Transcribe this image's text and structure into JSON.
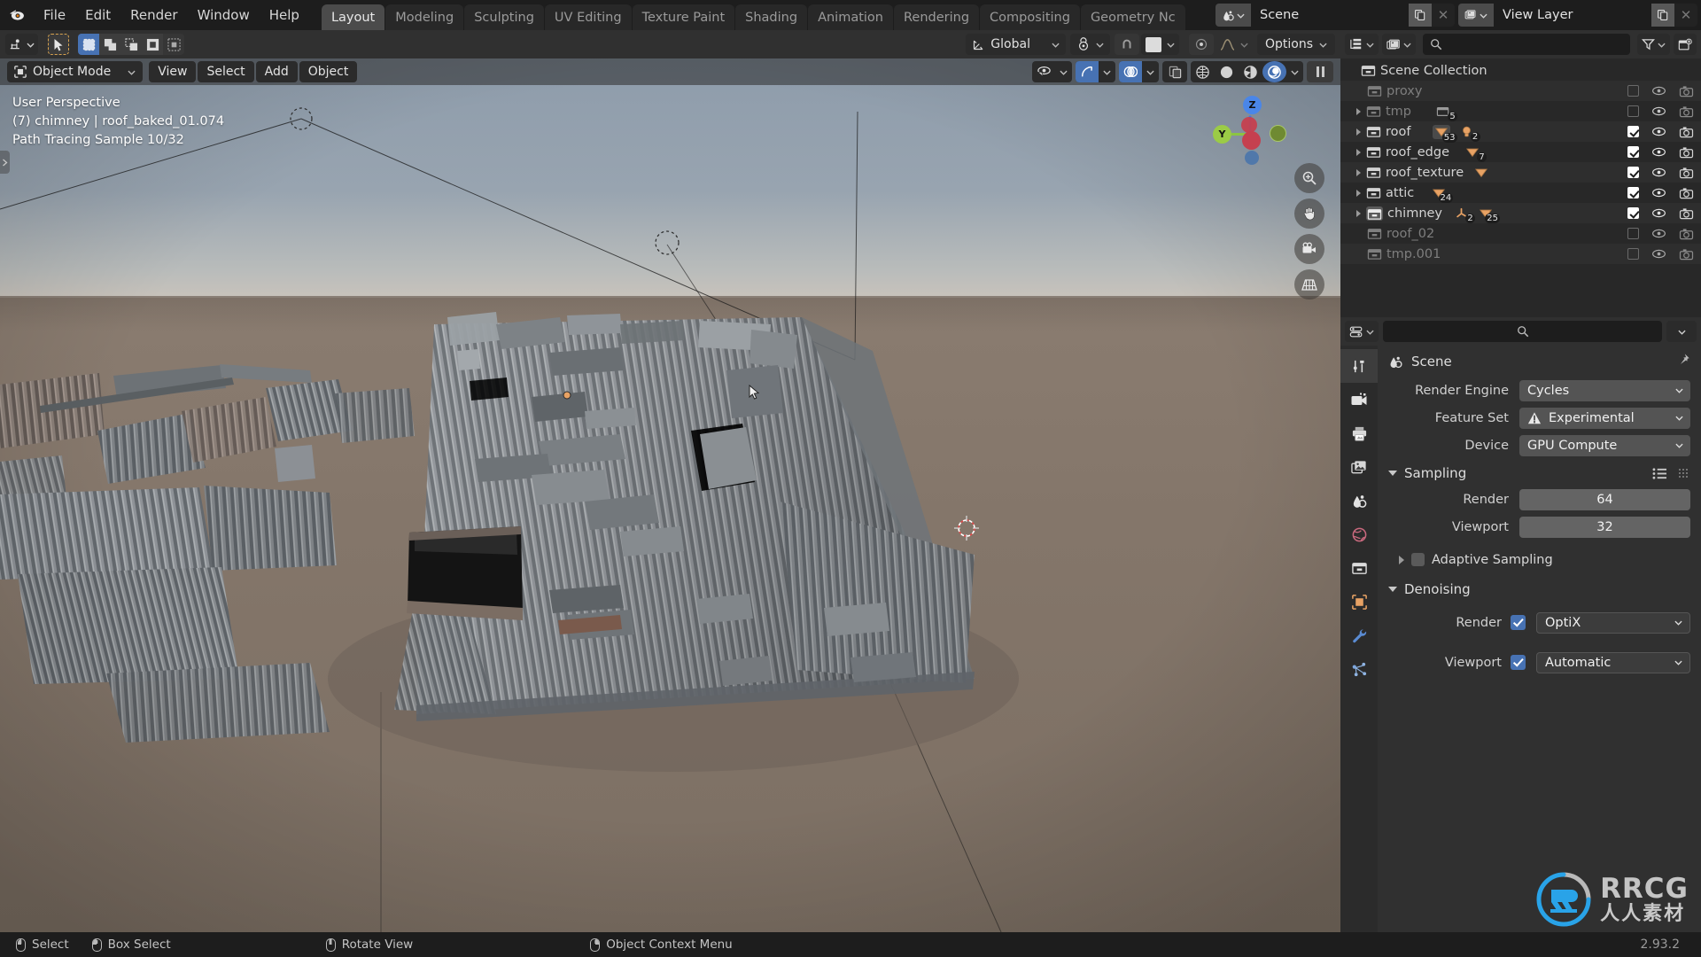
{
  "app": {
    "name": "Blender",
    "version": "2.93.2",
    "logo_icon": "blender-logo-icon"
  },
  "topbar": {
    "menus": [
      "File",
      "Edit",
      "Render",
      "Window",
      "Help"
    ],
    "workspace_tabs": [
      {
        "label": "Layout",
        "active": true
      },
      {
        "label": "Modeling",
        "active": false
      },
      {
        "label": "Sculpting",
        "active": false
      },
      {
        "label": "UV Editing",
        "active": false
      },
      {
        "label": "Texture Paint",
        "active": false
      },
      {
        "label": "Shading",
        "active": false
      },
      {
        "label": "Animation",
        "active": false
      },
      {
        "label": "Rendering",
        "active": false
      },
      {
        "label": "Compositing",
        "active": false
      },
      {
        "label": "Geometry Nc",
        "active": false
      }
    ],
    "scene_name": "Scene",
    "view_layer_name": "View Layer",
    "scene_icon": "scene-icon",
    "view_layer_icon": "view-layer-icon",
    "duplicate_icon": "duplicate-icon",
    "close_icon": "close-icon"
  },
  "toolheader": {
    "editor_type_icon": "editor-type-icon",
    "cursor_tool_icon": "cursor-select-icon",
    "select_modes": [
      "set-select-icon",
      "extend-select-icon",
      "subtract-select-icon",
      "invert-select-icon",
      "intersect-select-icon"
    ],
    "transform_orientation": "Global",
    "orientation_icon": "orientation-gizmo-icon",
    "snap_icon": "magnet-icon",
    "pivot_icon": "pivot-point-icon",
    "proportional_icon": "proportional-edit-icon",
    "falloff_icon": "falloff-curve-icon",
    "options_label": "Options"
  },
  "viewport": {
    "mode": "Object Mode",
    "mode_icon": "object-mode-icon",
    "menus": [
      "View",
      "Select",
      "Add",
      "Object"
    ],
    "overlay_text": {
      "perspective": "User Perspective",
      "active_object": "(7) chimney | roof_baked_01.074",
      "render_progress": "Path Tracing Sample 10/32"
    },
    "header_right": {
      "visibility_icon": "object-visibility-icon",
      "gizmo_icon": "gizmo-icon",
      "gizmo_active": true,
      "overlays_icon": "overlays-icon",
      "overlays_active": true,
      "xray_icon": "xray-toggle-icon",
      "shading_modes": [
        {
          "icon": "wireframe-shading-icon",
          "active": false
        },
        {
          "icon": "solid-shading-icon",
          "active": false
        },
        {
          "icon": "material-preview-shading-icon",
          "active": false
        },
        {
          "icon": "rendered-shading-icon",
          "active": true
        }
      ],
      "pause_icon": "pause-render-icon"
    },
    "gizmo_axes": [
      {
        "label": "Z",
        "color": "#4772dd"
      },
      {
        "label": "Y",
        "color": "#8cc442"
      },
      {
        "label": "X",
        "color": "#cc3344"
      }
    ],
    "nav_tools": [
      "zoom-icon",
      "pan-hand-icon",
      "camera-view-icon",
      "orthographic-toggle-icon"
    ],
    "cursor_3d_icon": "3d-cursor-icon",
    "sidebar_toggle_icon": "sidebar-expand-icon",
    "scene_description": "Corrugated metal roof 3D model with scattered debris pieces, rendered in Cycles"
  },
  "outliner": {
    "header": {
      "display_mode_icon": "outliner-display-mode-icon",
      "filter_id_icon": "filter-id-type-icon",
      "search_icon": "search-icon",
      "search_value": "",
      "filter_icon": "filter-funnel-icon",
      "new_collection_icon": "new-collection-icon"
    },
    "column_icons": [
      "selectable-checkbox",
      "hide-in-viewport-eye",
      "disable-in-render-camera"
    ],
    "root": "Scene Collection",
    "items": [
      {
        "name": "proxy",
        "dim": true,
        "expandable": false,
        "checked": false,
        "badges": []
      },
      {
        "name": "tmp",
        "dim": true,
        "expandable": true,
        "checked": false,
        "badges": [
          {
            "type": "collection",
            "count": "5"
          }
        ]
      },
      {
        "name": "roof",
        "dim": false,
        "expandable": true,
        "checked": true,
        "selected_icon": true,
        "badges": [
          {
            "type": "mesh",
            "count": "53"
          },
          {
            "type": "light",
            "count": "2"
          }
        ]
      },
      {
        "name": "roof_edge",
        "dim": false,
        "expandable": true,
        "checked": true,
        "badges": [
          {
            "type": "mesh",
            "count": "7"
          }
        ]
      },
      {
        "name": "roof_texture",
        "dim": false,
        "expandable": true,
        "checked": true,
        "badges": [
          {
            "type": "mesh",
            "count": ""
          }
        ]
      },
      {
        "name": "attic",
        "dim": false,
        "expandable": true,
        "checked": true,
        "badges": [
          {
            "type": "mesh",
            "count": "24"
          }
        ]
      },
      {
        "name": "chimney",
        "dim": false,
        "expandable": true,
        "checked": true,
        "highlight": true,
        "badges": [
          {
            "type": "empty",
            "count": "2"
          },
          {
            "type": "mesh",
            "count": "25"
          }
        ]
      },
      {
        "name": "roof_02",
        "dim": true,
        "expandable": false,
        "checked": false,
        "badges": []
      },
      {
        "name": "tmp.001",
        "dim": true,
        "expandable": false,
        "checked": false,
        "badges": []
      }
    ]
  },
  "properties": {
    "header": {
      "editor_icon": "properties-editor-icon",
      "search_icon": "search-icon",
      "search_value": "",
      "dropdown_icon": "chevron-down-icon"
    },
    "tabs": [
      {
        "icon": "tool-icon",
        "active": true
      },
      {
        "icon": "render-camera-icon",
        "active": false
      },
      {
        "icon": "output-printer-icon",
        "active": false
      },
      {
        "icon": "view-layer-images-icon",
        "active": false
      },
      {
        "icon": "scene-icon",
        "active": false
      },
      {
        "icon": "world-globe-icon",
        "active": false
      },
      {
        "icon": "collection-box-icon",
        "active": false
      },
      {
        "icon": "object-square-icon",
        "active": false
      },
      {
        "icon": "modifier-wrench-icon",
        "active": false
      },
      {
        "icon": "particles-icon",
        "active": false
      }
    ],
    "breadcrumb": "Scene",
    "breadcrumb_icon": "scene-icon",
    "pin_icon": "pin-icon",
    "fields": [
      {
        "label": "Render Engine",
        "value": "Cycles",
        "warn": false
      },
      {
        "label": "Feature Set",
        "value": "Experimental",
        "warn": true
      },
      {
        "label": "Device",
        "value": "GPU Compute",
        "warn": false
      }
    ],
    "sampling": {
      "title": "Sampling",
      "expanded": true,
      "preset_icon": "preset-list-icon",
      "grip_icon": "grip-dots-icon",
      "rows": [
        {
          "label": "Render",
          "value": "64"
        },
        {
          "label": "Viewport",
          "value": "32"
        }
      ],
      "adaptive_sampling": {
        "label": "Adaptive Sampling",
        "checked": false,
        "expanded": false
      }
    },
    "denoising": {
      "title": "Denoising",
      "expanded": true,
      "rows": [
        {
          "label": "Render",
          "checked": true,
          "value": "OptiX"
        },
        {
          "label": "Viewport",
          "checked": true,
          "value": "Automatic"
        }
      ]
    }
  },
  "statusbar": {
    "items": [
      {
        "mouse": "lmb",
        "label": "Select"
      },
      {
        "mouse": "lmb-drag",
        "label": "Box Select"
      },
      {
        "mouse": "mmb",
        "label": "Rotate View"
      },
      {
        "mouse": "rmb",
        "label": "Object Context Menu"
      }
    ],
    "version": "2.93.2"
  },
  "watermark": {
    "brand": "RRCG",
    "subtitle": "人人素材",
    "logo_icon": "rrcg-logo-icon"
  },
  "colors": {
    "accent_blue": "#4772b3",
    "panel_bg": "#303030",
    "outliner_bg": "#282828",
    "topbar_bg": "#1d1d1d",
    "mesh_orange": "#e8a264",
    "axis_x": "#cc3344",
    "axis_y": "#8cc442",
    "axis_z": "#4772dd"
  }
}
